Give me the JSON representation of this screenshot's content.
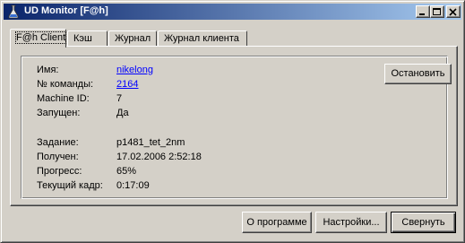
{
  "window": {
    "title": "UD Monitor [F@h]"
  },
  "title_buttons": {
    "minimize": "minimize-icon",
    "maximize": "maximize-icon",
    "close": "close-icon"
  },
  "tabs": [
    {
      "label": "F@h Client",
      "active": true
    },
    {
      "label": "Кэш",
      "active": false
    },
    {
      "label": "Журнал",
      "active": false
    },
    {
      "label": "Журнал клиента",
      "active": false
    }
  ],
  "info": {
    "name_label": "Имя:",
    "name_value": "nikelong",
    "team_label": "№ команды:",
    "team_value": "2164",
    "machine_label": "Machine ID:",
    "machine_value": "7",
    "running_label": "Запущен:",
    "running_value": "Да",
    "task_label": "Задание:",
    "task_value": "p1481_tet_2nm",
    "received_label": "Получен:",
    "received_value": "17.02.2006 2:52:18",
    "progress_label": "Прогресс:",
    "progress_value": "65%",
    "frame_label": "Текущий кадр:",
    "frame_value": "0:17:09"
  },
  "buttons": {
    "stop": "Остановить",
    "about": "О программе",
    "settings": "Настройки...",
    "collapse": "Свернуть"
  }
}
